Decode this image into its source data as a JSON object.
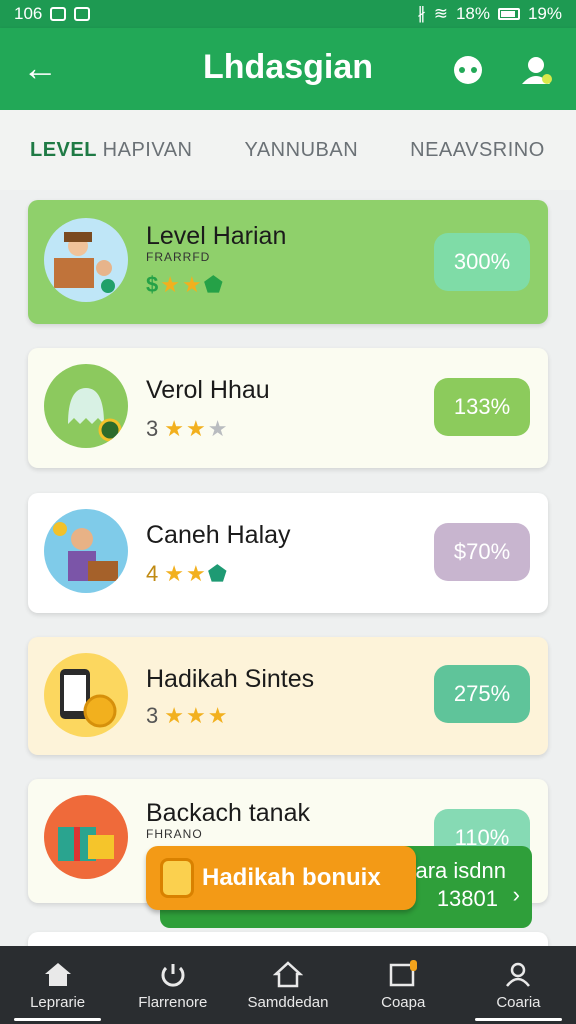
{
  "status_bar": {
    "time": "106",
    "battery_pct": "19%",
    "signal_text": "18%"
  },
  "app_bar": {
    "title": "Lhdasgian"
  },
  "tabs": [
    {
      "label": "LEVEL",
      "label_sub": "HAPIVAN"
    },
    {
      "label": "YANNUBAN"
    },
    {
      "label": "NEAAVSRINO"
    }
  ],
  "cards": [
    {
      "name": "Level Harian",
      "sub": "FRARRFD",
      "prefix": "$",
      "stars_on": 2,
      "percent": "300%",
      "bg": "#8fd06b",
      "badge_color": "#7fdca7"
    },
    {
      "name": "Verol Hhau",
      "level": "3",
      "stars_on": 2,
      "percent": "133%",
      "bg": "#fbfcf1",
      "badge_color": "#8ccb5c"
    },
    {
      "name": "Caneh Halay",
      "level": "4",
      "stars_on": 2,
      "percent": "$70%",
      "bg": "#ffffff",
      "badge_color": "#c8b5cf"
    },
    {
      "name": "Hadikah Sintes",
      "level": "3",
      "stars_on": 3,
      "percent": "275%",
      "bg": "#fdf3d9",
      "badge_color": "#5fc49a"
    },
    {
      "name": "Backach tanak",
      "sub": "FHRANO",
      "percent": "110%",
      "bg": "#fbfcf1",
      "badge_color": "#86dab4"
    }
  ],
  "bonus": {
    "label": "Hadikah bonuix"
  },
  "promo": {
    "line1": "ara isdnn",
    "line2": "13801"
  },
  "bottom_nav": [
    {
      "label": "Leprarie",
      "icon": "home-icon"
    },
    {
      "label": "Flarrenore",
      "icon": "refresh-icon"
    },
    {
      "label": "Samddedan",
      "icon": "house-outline-icon"
    },
    {
      "label": "Coapa",
      "icon": "window-icon"
    },
    {
      "label": "Coaria",
      "icon": "profile-icon"
    }
  ],
  "colors": {
    "primary": "#22a857",
    "status": "#1e9a52",
    "orange": "#f39a16",
    "nav": "#2a2d30"
  }
}
